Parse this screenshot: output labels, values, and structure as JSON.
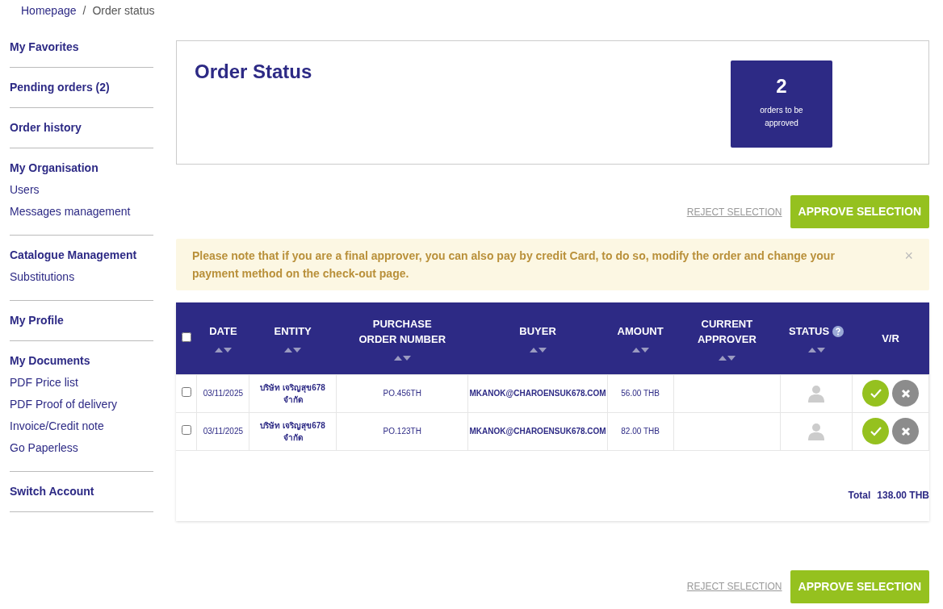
{
  "breadcrumb": [
    {
      "label": "Homepage",
      "link": true
    },
    {
      "label": "Order status",
      "link": false
    }
  ],
  "breadcrumb_separator": "/",
  "sidebar": [
    {
      "heading": "My Favorites"
    },
    {
      "heading": "Pending orders (2)"
    },
    {
      "heading": "Order history"
    },
    {
      "heading": "My Organisation",
      "links": [
        "Users",
        "Messages management"
      ]
    },
    {
      "heading": "Catalogue Management",
      "links": [
        "Substitutions"
      ]
    },
    {
      "heading": "My Profile"
    },
    {
      "heading": "My Documents",
      "links": [
        "PDF Price list",
        "PDF Proof of delivery",
        "Invoice/Credit note",
        "Go Paperless"
      ]
    },
    {
      "heading": "Switch Account"
    }
  ],
  "header": {
    "title": "Order Status",
    "count": "2",
    "count_label": "orders to be approved"
  },
  "actions_top": {
    "reject": "REJECT SELECTION",
    "approve": "APPROVE SELECTION"
  },
  "alert": {
    "text": "Please note that if you are a final approver, you can also pay by credit Card, to do so, modify the order and change your payment method on the check-out page.",
    "close": "×"
  },
  "table": {
    "select_all_checked": false,
    "columns": [
      {
        "label": "DATE",
        "sortable": true,
        "help": false
      },
      {
        "label": "ENTITY",
        "sortable": true,
        "help": false
      },
      {
        "label": "PURCHASE ORDER NUMBER",
        "sortable": true,
        "help": false
      },
      {
        "label": "BUYER",
        "sortable": true,
        "help": false
      },
      {
        "label": "AMOUNT",
        "sortable": true,
        "help": false
      },
      {
        "label": "CURRENT APPROVER",
        "sortable": true,
        "help": false
      },
      {
        "label": "STATUS",
        "sortable": true,
        "help": true
      },
      {
        "label": "V/R",
        "sortable": false,
        "help": false
      }
    ],
    "rows": [
      {
        "checked": false,
        "date": "03/11/2025",
        "entity": "บริษัท เจริญสุข678 จำกัด",
        "po": "PO.456TH",
        "buyer": "MKANOK@CHAROENSUK678.COM",
        "amount": "56.00 THB"
      },
      {
        "checked": false,
        "date": "03/11/2025",
        "entity": "บริษัท เจริญสุข678 จำกัด",
        "po": "PO.123TH",
        "buyer": "MKANOK@CHAROENSUK678.COM",
        "amount": "82.00 THB"
      }
    ],
    "total_label": "Total",
    "total": "138.00 THB"
  },
  "actions_bottom": {
    "reject": "REJECT SELECTION",
    "approve": "APPROVE SELECTION"
  }
}
